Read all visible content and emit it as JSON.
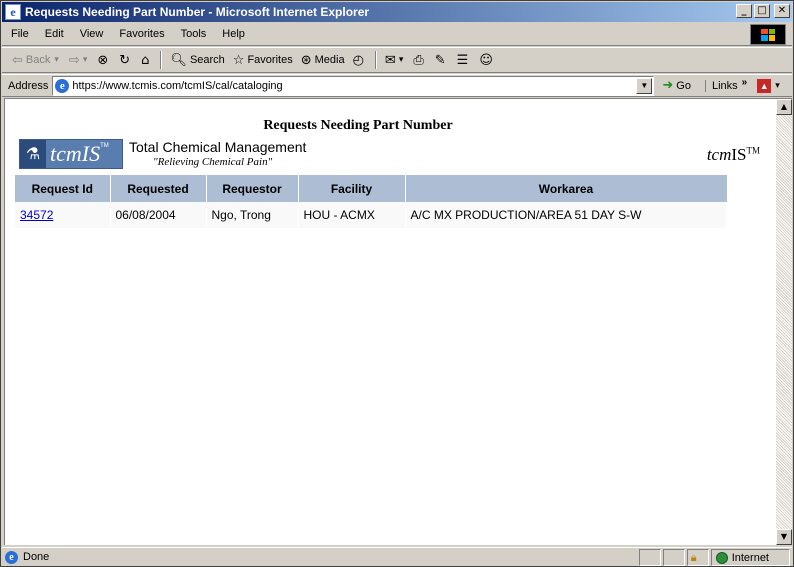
{
  "window": {
    "title": "Requests Needing Part Number - Microsoft Internet Explorer",
    "controls": {
      "minimize": "_",
      "maximize": "□",
      "close": "✕"
    }
  },
  "menu": [
    "File",
    "Edit",
    "View",
    "Favorites",
    "Tools",
    "Help"
  ],
  "toolbar": {
    "back": "Back",
    "search": "Search",
    "favorites": "Favorites",
    "media": "Media"
  },
  "address": {
    "label": "Address",
    "url": "https://www.tcmis.com/tcmIS/cal/cataloging",
    "go": "Go",
    "links": "Links"
  },
  "page": {
    "heading": "Requests Needing Part Number",
    "logo_text": "tcmIS",
    "logo_tm": "TM",
    "company_name": "Total Chemical Management",
    "slogan": "\"Relieving Chemical Pain\"",
    "brand_right_prefix": "tcm",
    "brand_right_suffix": "IS",
    "brand_right_tm": "TM"
  },
  "table": {
    "columns": [
      "Request Id",
      "Requested",
      "Requestor",
      "Facility",
      "Workarea"
    ],
    "rows": [
      {
        "request_id": "34572",
        "requested": "06/08/2004",
        "requestor": "Ngo, Trong",
        "facility": "HOU - ACMX",
        "workarea": "A/C MX PRODUCTION/AREA 51 DAY S-W"
      }
    ]
  },
  "status": {
    "text": "Done",
    "zone": "Internet"
  },
  "colors": {
    "title_bar_start": "#0a246a",
    "title_bar_end": "#a6caf0",
    "table_header": "#adbdd4",
    "link": "#0000cc"
  }
}
